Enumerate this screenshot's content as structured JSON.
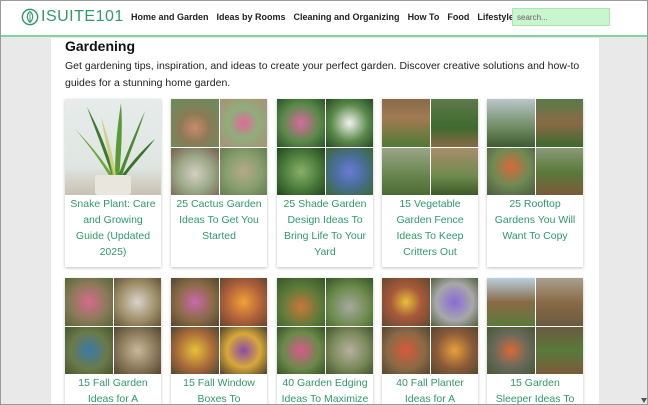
{
  "header": {
    "logo_text": "ISUITE101",
    "nav": [
      "Home and Garden",
      "Ideas by Rooms",
      "Cleaning and Organizing",
      "How To",
      "Food",
      "Lifestyle"
    ],
    "search_placeholder": "search..."
  },
  "page": {
    "title": "Gardening",
    "intro": "Get gardening tips, inspiration, and ideas to create your perfect garden. Discover creative solutions and how-to guides for a stunning home garden."
  },
  "cards": [
    {
      "caption": "Snake Plant: Care and Growing Guide (Updated 2025)"
    },
    {
      "caption": "25 Cactus Garden Ideas To Get You Started"
    },
    {
      "caption": "25 Shade Garden Design Ideas To Bring Life To Your Yard"
    },
    {
      "caption": "15 Vegetable Garden Fence Ideas To Keep Critters Out"
    },
    {
      "caption": "25 Rooftop Gardens You Will Want To Copy"
    },
    {
      "caption": "15 Fall Garden Ideas for A"
    },
    {
      "caption": "15 Fall Window Boxes To"
    },
    {
      "caption": "40 Garden Edging Ideas To Maximize"
    },
    {
      "caption": "40 Fall Planter Ideas for A"
    },
    {
      "caption": "15 Garden Sleeper Ideas To"
    }
  ],
  "colors": {
    "accent": "#2f9a68",
    "search_bg": "#c9f5cf",
    "header_border": "#7fd6a2"
  }
}
